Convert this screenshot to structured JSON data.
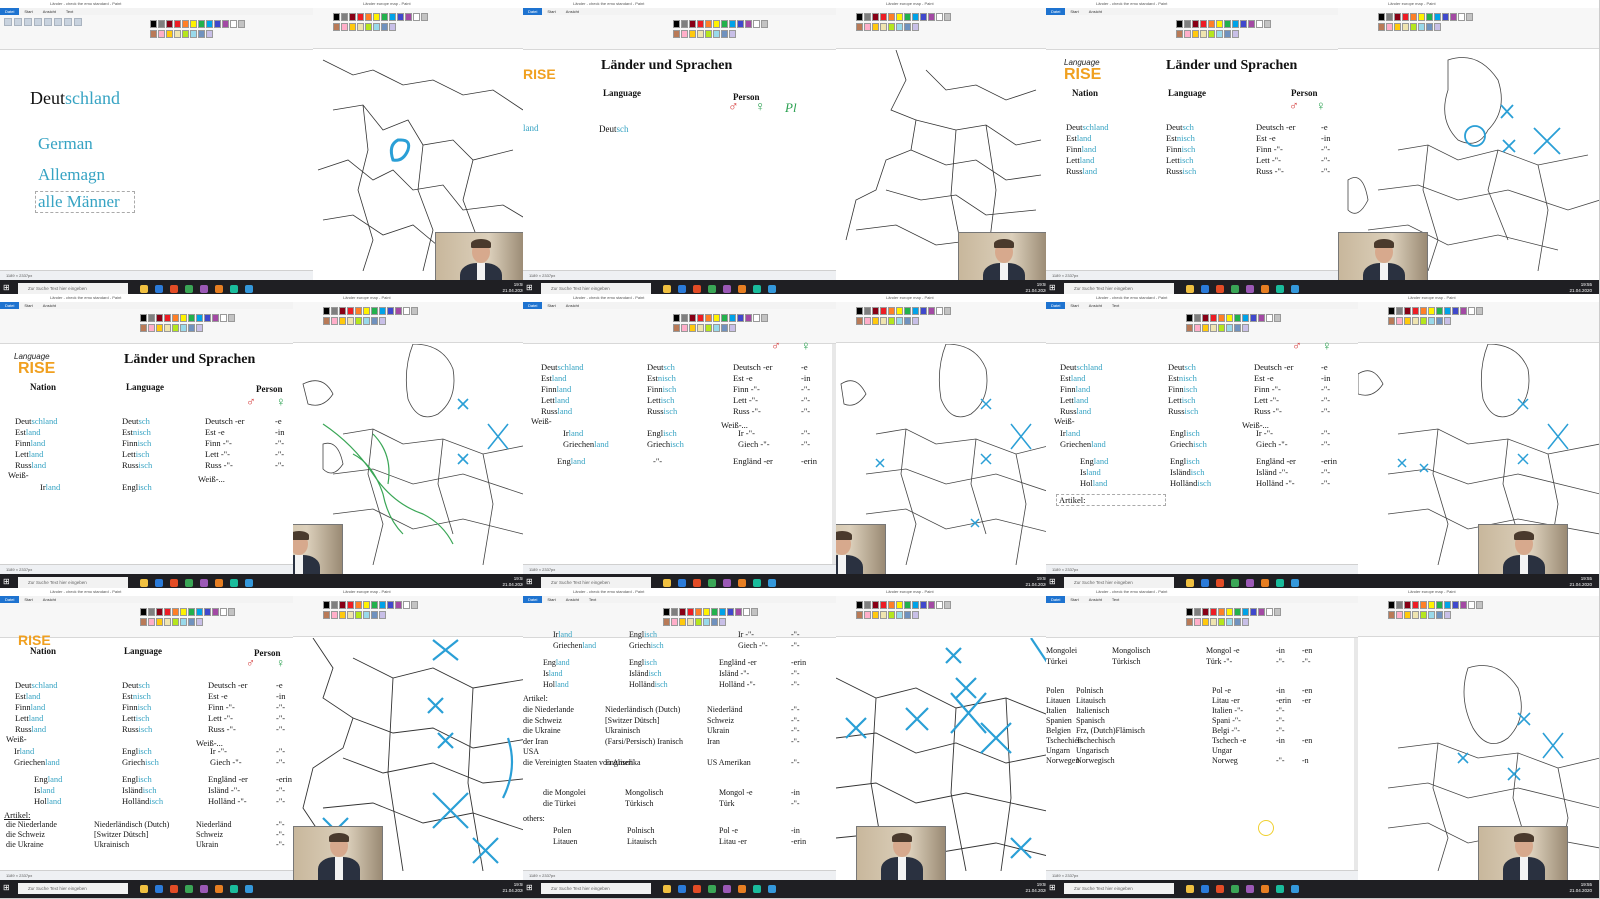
{
  "window": {
    "title_1": "Länder - check the emo standard - Paint",
    "title_2": "Länder europe map - Paint",
    "menu": [
      "Datei",
      "Start",
      "Ansicht",
      "Text"
    ],
    "status_size": "1189 × 2337px",
    "status_zoom": "100 %"
  },
  "taskbar": {
    "search_placeholder": "Zur Suche Text hier eingeben",
    "time": "19:55",
    "date": "21.04.2020"
  },
  "palette": [
    "#000000",
    "#7f7f7f",
    "#880015",
    "#ed1c24",
    "#ff7f27",
    "#fff200",
    "#22b14c",
    "#00a2e8",
    "#3f48cc",
    "#a349a4",
    "#ffffff",
    "#c3c3c3",
    "#b97a57",
    "#ffaec9",
    "#ffc90e",
    "#efe4b0",
    "#b5e61d",
    "#99d9ea",
    "#7092be",
    "#c8bfe7"
  ],
  "logo": {
    "top": "Language",
    "bottom": "RISE"
  },
  "tile1": {
    "word1_a": "Deut",
    "word1_b": "schland",
    "word2": "German",
    "word3": "Allemagn",
    "word4": "alle Männer"
  },
  "headers": {
    "title": "Länder und Sprachen",
    "nation": "Nation",
    "language": "Language",
    "person": "Person",
    "male": "♂",
    "female": "♀",
    "plural": "Pl"
  },
  "countries": [
    {
      "stem": "Deut",
      "suf": "schland",
      "lang_stem": "Deut",
      "lang_suf": "sch",
      "person": "Deutsch -er",
      "fem": "-e"
    },
    {
      "stem": "Est",
      "suf": "land",
      "lang_stem": "Est",
      "lang_suf": "nisch",
      "person": "Est -e",
      "fem": "-in"
    },
    {
      "stem": "Finn",
      "suf": "land",
      "lang_stem": "Finn",
      "lang_suf": "isch",
      "person": "Finn -\"-",
      "fem": "-\"-"
    },
    {
      "stem": "Lett",
      "suf": "land",
      "lang_stem": "Lett",
      "lang_suf": "isch",
      "person": "Lett -\"-",
      "fem": "-\"-"
    },
    {
      "stem": "Russ",
      "suf": "land",
      "lang_stem": "Russ",
      "lang_suf": "isch",
      "person": "Russ -\"-",
      "fem": "-\"-"
    },
    {
      "stem": "Ir",
      "suf": "land",
      "lang_stem": "Engl",
      "lang_suf": "isch",
      "person": "Ir -\"-",
      "fem": "-\"-"
    },
    {
      "stem": "Griechen",
      "suf": "land",
      "lang_stem": "Griech",
      "lang_suf": "isch",
      "person": "Giech -\"-",
      "fem": "-\"-"
    },
    {
      "stem": "Eng",
      "suf": "land",
      "lang_stem": "Engl",
      "lang_suf": "isch",
      "person": "Engländ -er",
      "fem": "-erin"
    },
    {
      "stem": "Is",
      "suf": "land",
      "lang_stem": "Isländ",
      "lang_suf": "isch",
      "person": "Isländ -\"-",
      "fem": "-\"-"
    },
    {
      "stem": "Hol",
      "suf": "land",
      "lang_stem": "Holländ",
      "lang_suf": "isch",
      "person": "Holländ -\"-",
      "fem": "-\"-"
    }
  ],
  "labels": {
    "weiss": "Weiß-",
    "weiss2": "Weiß-...",
    "artikel": "Artikel:",
    "others": "others:",
    "dash": "-\"-"
  },
  "artikel_rows": [
    {
      "nation": "die Niederlande",
      "lang": "Niederländisch (Dutch)",
      "person": "Niederländ",
      "fem": "-\"-"
    },
    {
      "nation": "die Schweiz",
      "lang": "[Switzer Dütsch]",
      "person": "Schweiz",
      "fem": "-\"-"
    },
    {
      "nation": "die Ukraine",
      "lang": "Ukrainisch",
      "person": "Ukrain",
      "fem": "-\"-"
    },
    {
      "nation": "der Iran",
      "lang": "(Farsi/Persisch) Iranisch",
      "person": "Iran",
      "fem": "-\"-"
    },
    {
      "nation": "USA",
      "lang": "",
      "person": "",
      "fem": ""
    },
    {
      "nation": "die Vereinigten Staaten von Amerika",
      "lang": "Englisch",
      "person": "US Amerikan",
      "fem": "-\"-"
    },
    {
      "nation": "die Mongolei",
      "lang": "Mongolisch",
      "person": "Mongol -e",
      "fem": "-in"
    },
    {
      "nation": "die Türkei",
      "lang": "Türkisch",
      "person": "Türk",
      "fem": "-\"-"
    }
  ],
  "others_rows": [
    {
      "nation": "Polen",
      "lang": "Polnisch",
      "person": "Pol -e",
      "fem": "-in",
      "pl": "-en"
    },
    {
      "nation": "Litauen",
      "lang": "Litauisch",
      "person": "Litau -er",
      "fem": "-erin",
      "pl": "-er"
    },
    {
      "nation": "Italien",
      "lang": "Italienisch",
      "person": "Italien -\"-",
      "fem": "-\"-",
      "pl": ""
    },
    {
      "nation": "Spanien",
      "lang": "Spanisch",
      "person": "Spani -\"-",
      "fem": "-\"-",
      "pl": ""
    },
    {
      "nation": "Belgien",
      "lang": "Frz, (Dutch)Flämisch",
      "person": "Belgi -\"-",
      "fem": "-\"-",
      "pl": ""
    },
    {
      "nation": "Tschechien",
      "lang": "Tschechisch",
      "person": "Tschech -e",
      "fem": "-in",
      "pl": "-en"
    },
    {
      "nation": "Ungarn",
      "lang": "Ungarisch",
      "person": "Ungar",
      "fem": "",
      "pl": ""
    },
    {
      "nation": "Norwegen",
      "lang": "Norwegisch",
      "person": "Norweg",
      "fem": "-\"-",
      "pl": "-n"
    }
  ],
  "tile9_top": [
    {
      "nation": "Mongolei",
      "lang": "Mongolisch",
      "person": "Mongol -e",
      "fem": "-in",
      "pl": "-en"
    },
    {
      "nation": "Türkei",
      "lang": "Türkisch",
      "person": "Türk -\"-",
      "fem": "-\"-",
      "pl": "-\"-"
    }
  ]
}
